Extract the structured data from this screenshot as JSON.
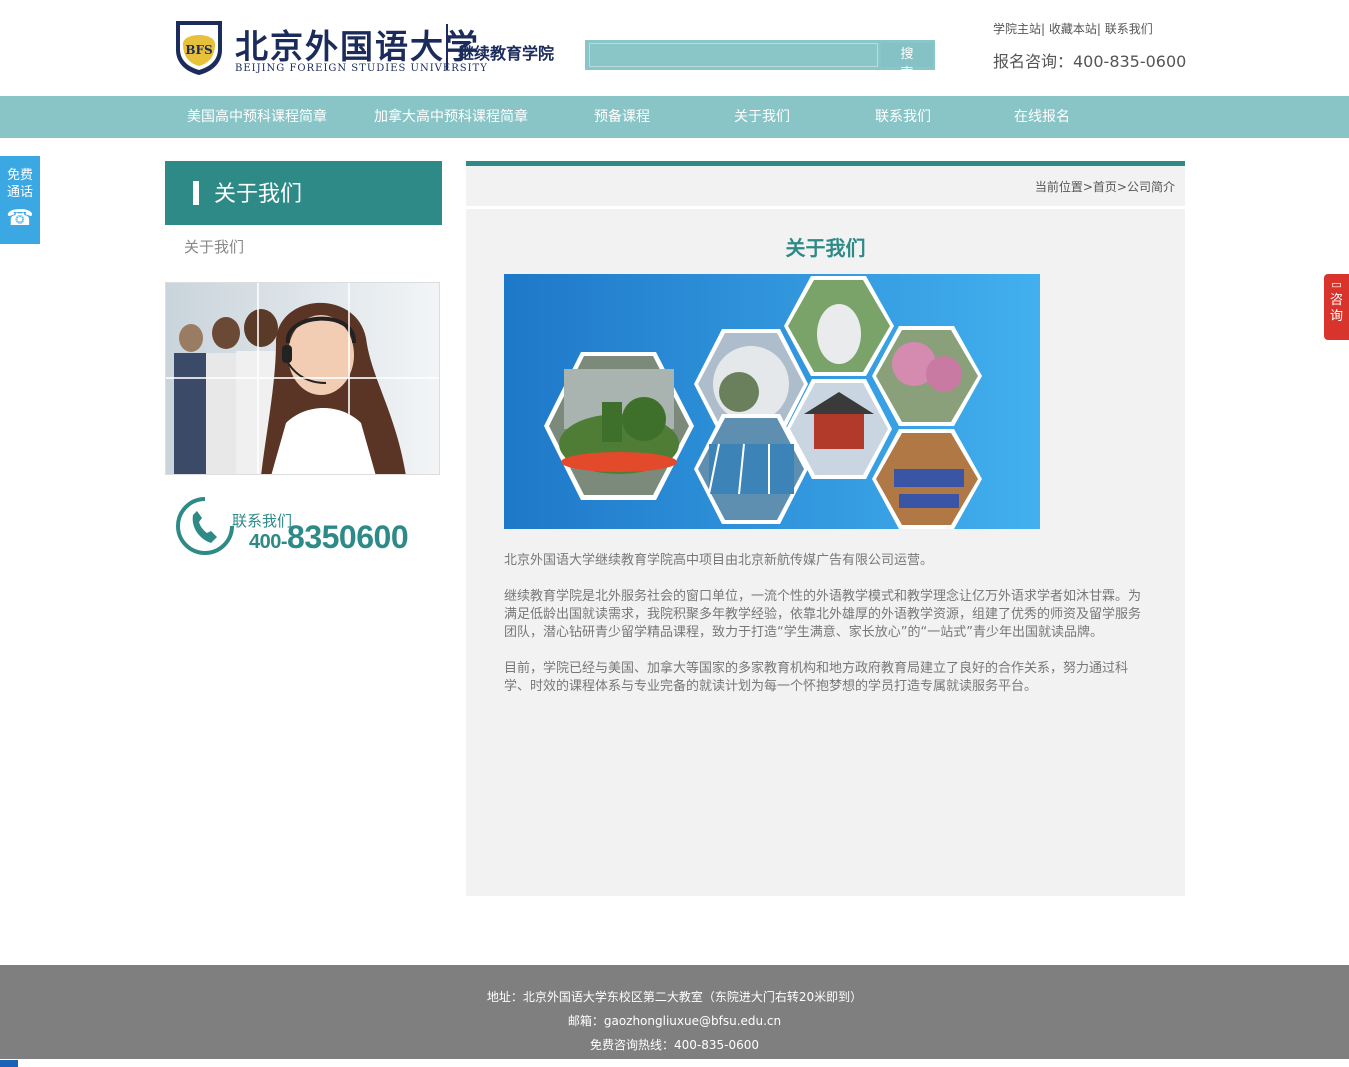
{
  "header": {
    "logo_cn": "北京外国语大学",
    "logo_en": "Beijing Foreign Studies University",
    "logo_seal_text": "BFS",
    "logo_subtitle": "继续教育学院",
    "search": {
      "placeholder": "",
      "button_label": "搜 索"
    },
    "top_links": [
      "学院主站",
      "收藏本站",
      "联系我们"
    ],
    "hotline": "报名咨询：400-835-0600"
  },
  "nav": {
    "items": [
      {
        "label": "美国高中预科课程简章"
      },
      {
        "label": "加拿大高中预科课程简章"
      },
      {
        "label": "预备课程"
      },
      {
        "label": "关于我们"
      },
      {
        "label": "联系我们"
      },
      {
        "label": "在线报名"
      }
    ]
  },
  "sidebar": {
    "title": "关于我们",
    "link": "关于我们",
    "contact_label": "联系我们",
    "contact_prefix": "400-",
    "contact_number": "8350600"
  },
  "breadcrumb": {
    "label": "当前位置",
    "items": [
      "首页",
      "公司简介"
    ],
    "separator": ">"
  },
  "main": {
    "title": "关于我们",
    "paragraphs": [
      "北京外国语大学继续教育学院高中项目由北京新航传媒广告有限公司运营。",
      "继续教育学院是北外服务社会的窗口单位，一流个性的外语教学模式和教学理念让亿万外语求学者如沐甘霖。为满足低龄出国就读需求，我院积聚多年教学经验，依靠北外雄厚的外语教学资源，组建了优秀的师资及留学服务团队，潜心钻研青少留学精品课程，致力于打造“学生满意、家长放心”的“一站式”青少年出国就读品牌。",
      "目前，学院已经与美国、加拿大等国家的多家教育机构和地方政府教育局建立了良好的合作关系，努力通过科学、时效的课程体系与专业完备的就读计划为每一个怀抱梦想的学员打造专属就读服务平台。"
    ]
  },
  "floats": {
    "call_line1": "免费",
    "call_line2": "通话",
    "call_icon": "telephone-icon",
    "consult_icon": "chat-icon",
    "consult_label": "咨询"
  },
  "footer": {
    "address": "地址：北京外国语大学东校区第二大教室（东院进大门右转20米即到）",
    "email": "邮箱：gaozhongliuxue@bfsu.edu.cn",
    "hotline": "免费咨询热线：400-835-0600"
  },
  "colors": {
    "teal": "#2e8a87",
    "nav": "#89c5c7",
    "panel": "#f2f2f2",
    "footer": "#7f7f7f",
    "call_blue": "#3ba7e3",
    "consult_red": "#d9342b"
  }
}
